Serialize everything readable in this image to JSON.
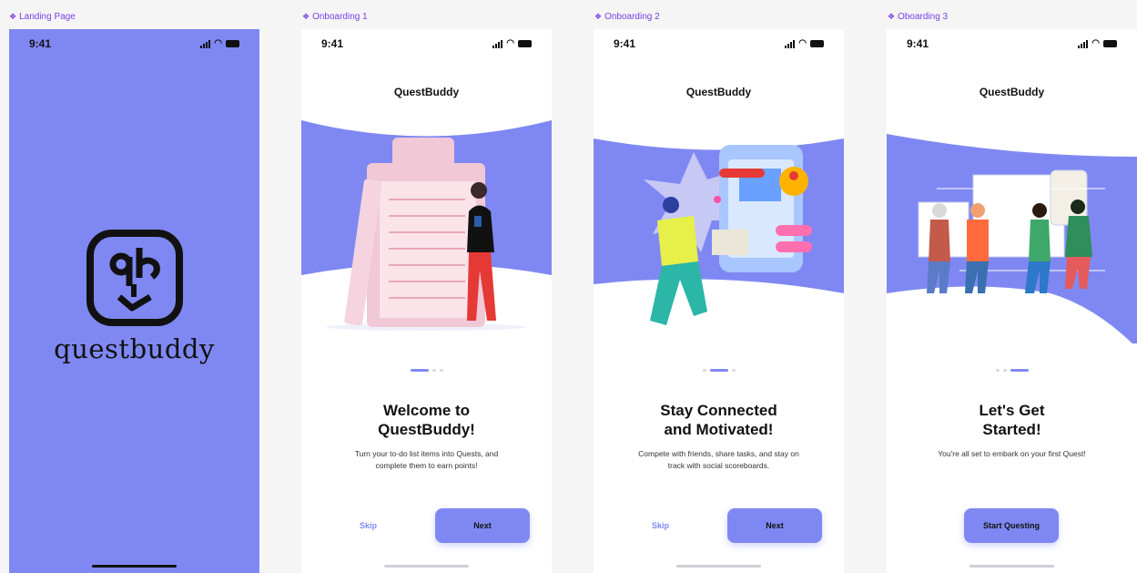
{
  "frames": [
    {
      "label": "Landing Page"
    },
    {
      "label": "Onboarding 1"
    },
    {
      "label": "Onboarding 2"
    },
    {
      "label": "Oboarding 3"
    }
  ],
  "status": {
    "time": "9:41"
  },
  "landing": {
    "wordmark": "questbuddy"
  },
  "brand": "QuestBuddy",
  "screens": [
    {
      "title_line1": "Welcome to",
      "title_line2": "QuestBuddy!",
      "desc_line1": "Turn your to-do list items into Quests, and",
      "desc_line2": "complete them to earn points!",
      "skip_label": "Skip",
      "next_label": "Next"
    },
    {
      "title_line1": "Stay Connected",
      "title_line2": "and Motivated!",
      "desc_line1": "Compete with friends, share tasks, and stay on",
      "desc_line2": "track with social scoreboards.",
      "skip_label": "Skip",
      "next_label": "Next"
    },
    {
      "title_line1": "Let's Get",
      "title_line2": "Started!",
      "desc_line1": "You're all set to embark on your first Quest!",
      "start_label": "Start Questing"
    }
  ],
  "colors": {
    "accent": "#7f88f2",
    "label": "#7b3fe4",
    "text": "#111111"
  }
}
